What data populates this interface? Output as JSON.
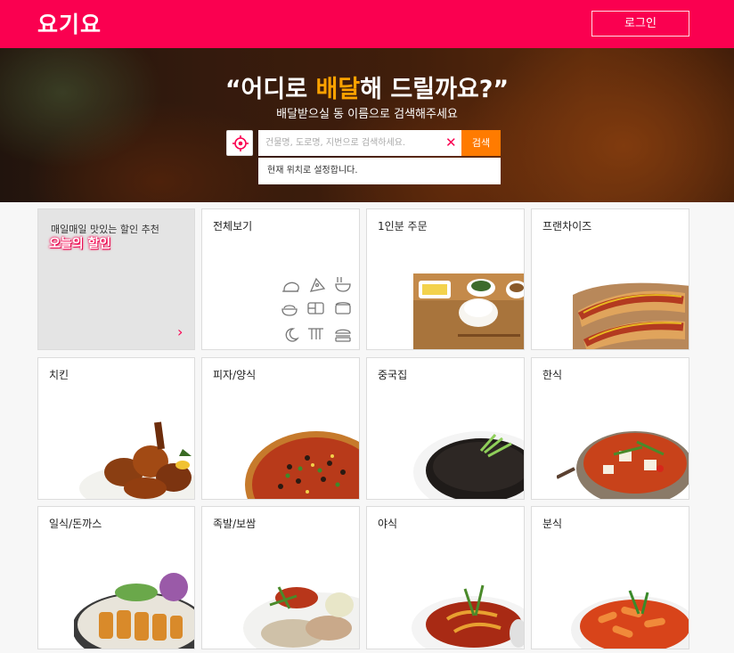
{
  "header": {
    "logo": "요기요",
    "login_label": "로그인",
    "brand_color": "#fa0050"
  },
  "hero": {
    "title_pre": "“어디로 ",
    "title_highlight": "배달",
    "title_post": "해 드릴까요?”",
    "subtitle": "배달받으실 동 이름으로 검색해주세요",
    "search": {
      "placeholder": "건물명, 도로명, 지번으로 검색하세요.",
      "value": "",
      "clear_icon": "close-icon",
      "button_label": "검색"
    },
    "location_icon": "crosshair-icon",
    "dropdown_option": "현재 위치로 설정합니다."
  },
  "categories": [
    {
      "label": "매일매일 맛있는 할인 추천",
      "sub": "오늘의 할인"
    },
    {
      "label": "전체보기"
    },
    {
      "label": "1인분 주문"
    },
    {
      "label": "프랜차이즈"
    },
    {
      "label": "치킨"
    },
    {
      "label": "피자/양식"
    },
    {
      "label": "중국집"
    },
    {
      "label": "한식"
    },
    {
      "label": "일식/돈까스"
    },
    {
      "label": "족발/보쌈"
    },
    {
      "label": "야식"
    },
    {
      "label": "분식"
    }
  ]
}
